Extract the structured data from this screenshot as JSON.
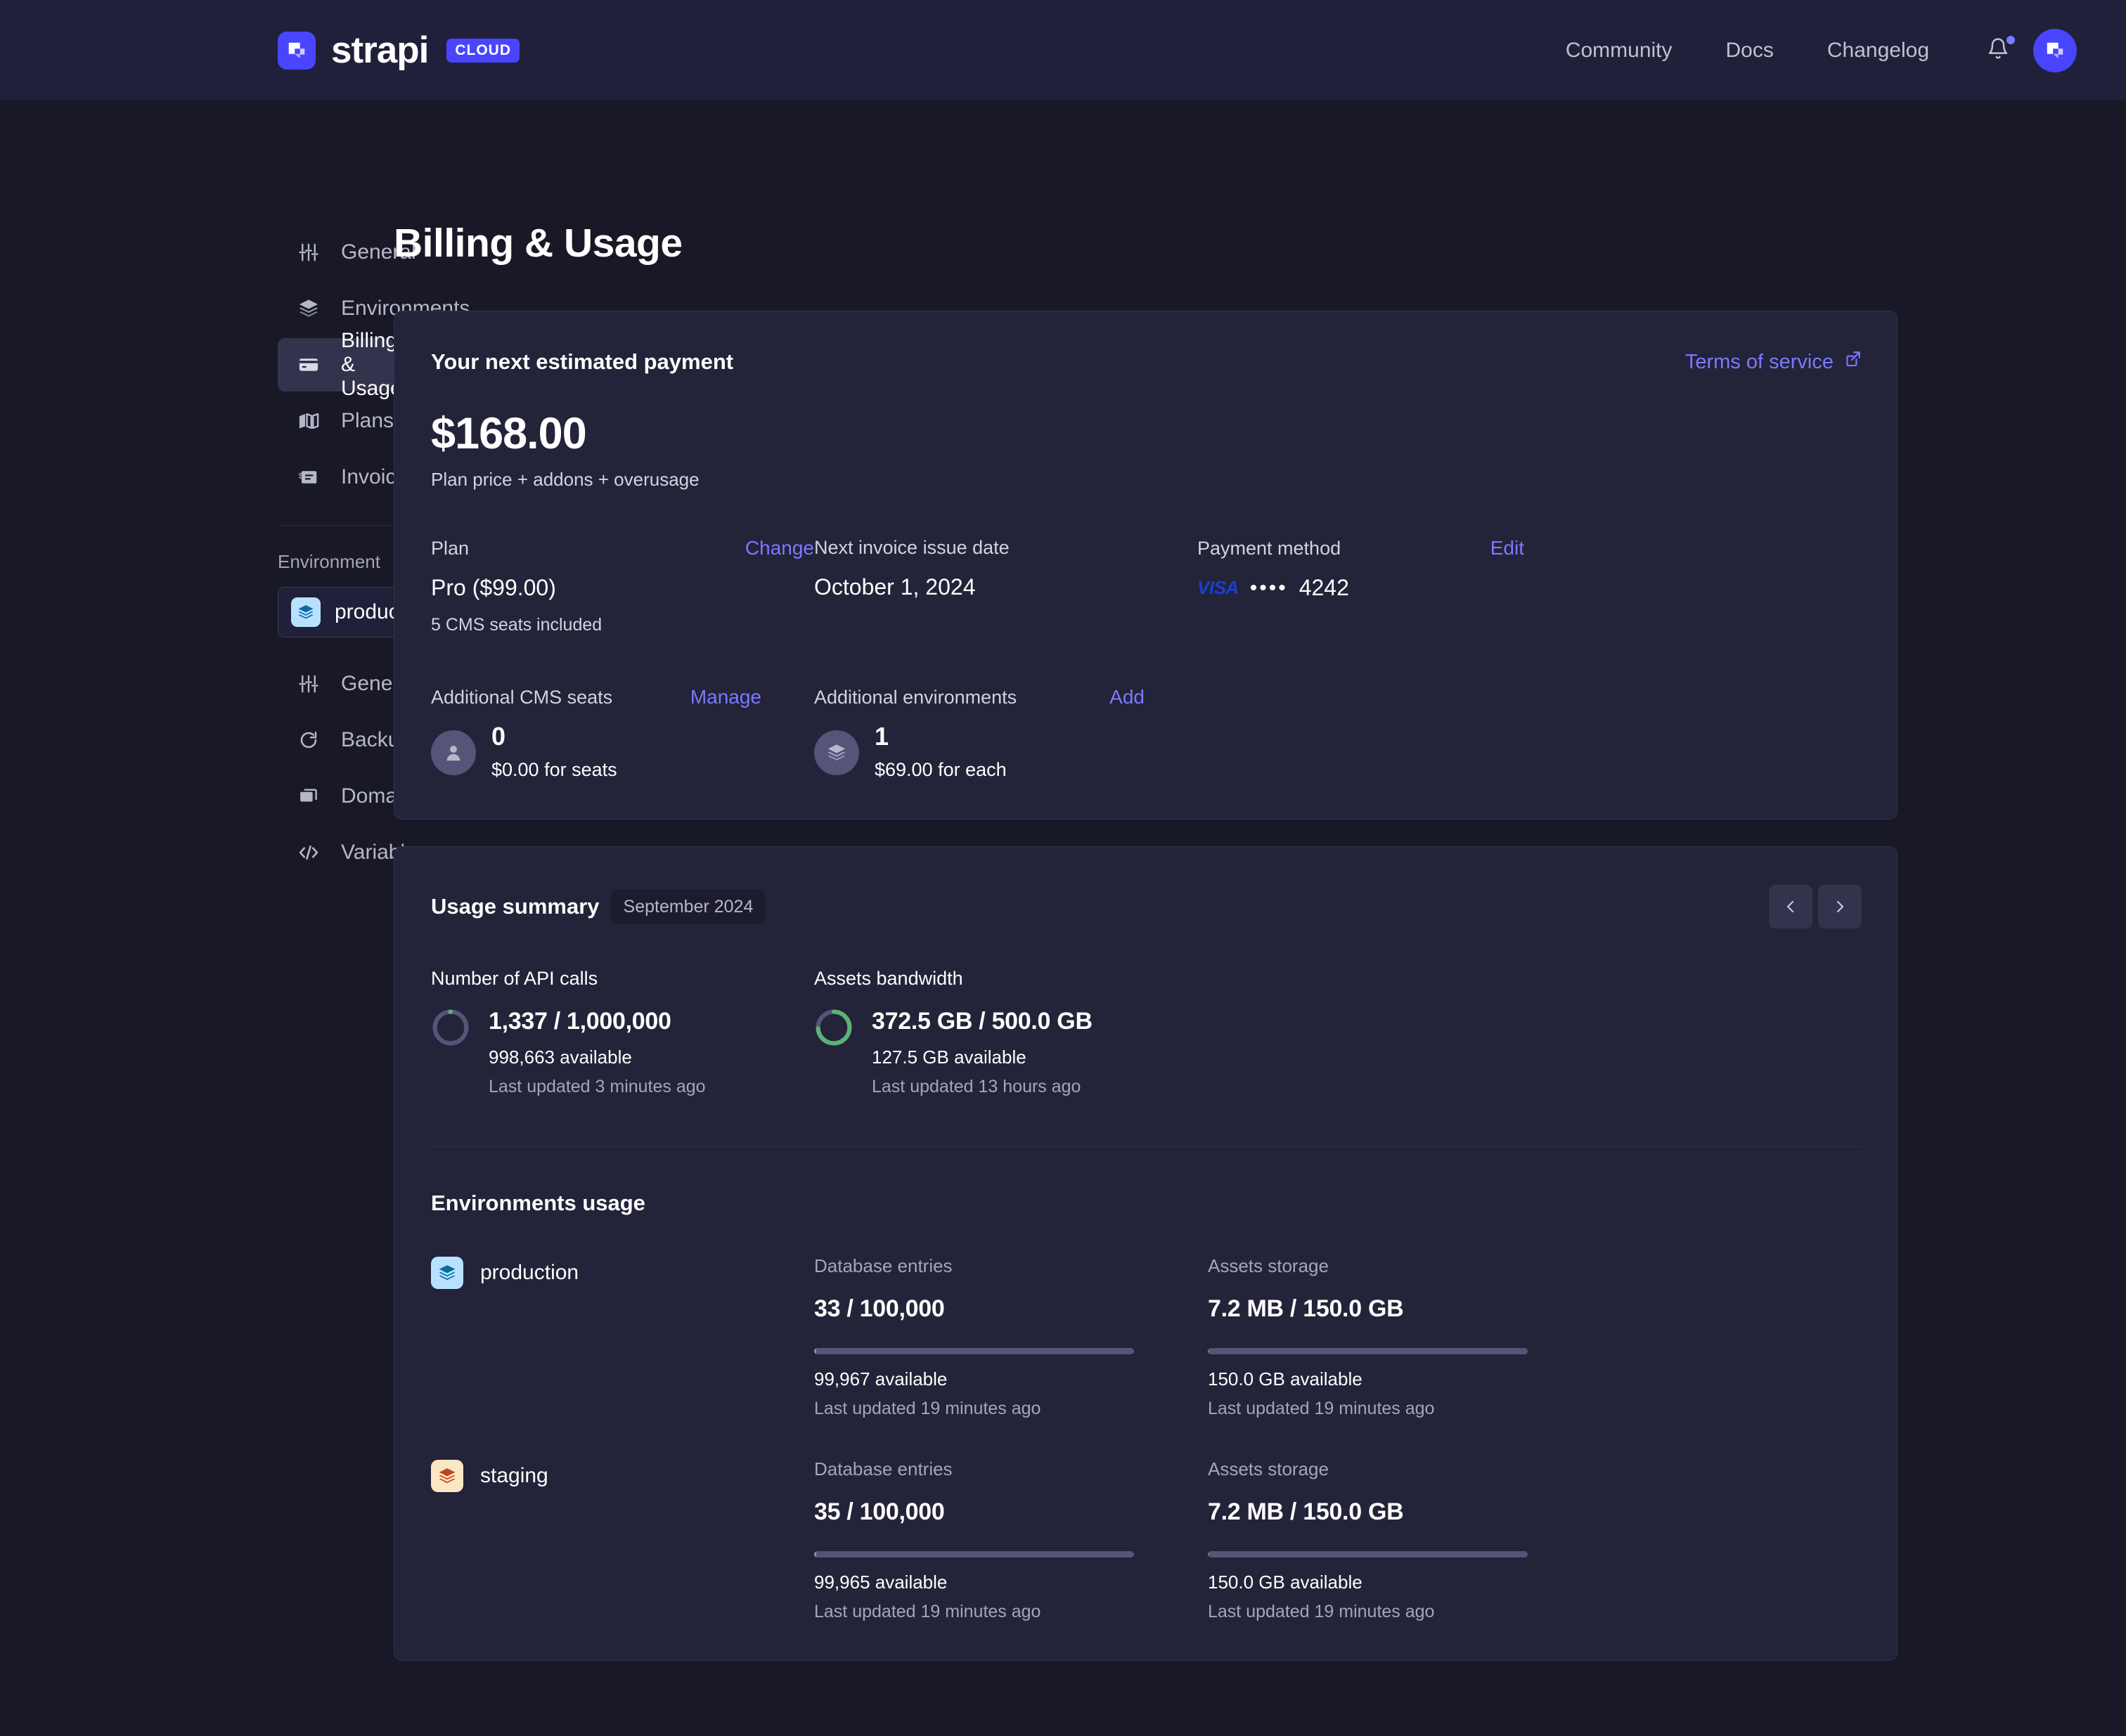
{
  "brand": {
    "word": "strapi",
    "badge": "CLOUD"
  },
  "topnav": {
    "links": [
      {
        "label": "Community"
      },
      {
        "label": "Docs"
      },
      {
        "label": "Changelog"
      }
    ],
    "notifications_icon": "bell-icon",
    "avatar_icon": "strapi-avatar-icon"
  },
  "sidebar": {
    "project_items": [
      {
        "label": "General",
        "icon": "sliders-icon",
        "active": false
      },
      {
        "label": "Environments",
        "icon": "layers-icon",
        "active": false
      },
      {
        "label": "Billing & Usage",
        "icon": "credit-card-icon",
        "active": true
      },
      {
        "label": "Plans",
        "icon": "map-icon",
        "active": false
      },
      {
        "label": "Invoices",
        "icon": "invoice-icon",
        "active": false
      }
    ],
    "environment_group_label": "Environment",
    "environment_selected": "production",
    "environment_items": [
      {
        "label": "General",
        "icon": "sliders-icon"
      },
      {
        "label": "Backups",
        "icon": "refresh-icon"
      },
      {
        "label": "Domains",
        "icon": "window-icon"
      },
      {
        "label": "Variables",
        "icon": "code-icon"
      }
    ]
  },
  "page_title": "Billing & Usage",
  "payment_card": {
    "title": "Your next estimated payment",
    "terms_link": "Terms of service",
    "amount": "$168.00",
    "amount_sub": "Plan price + addons + overusage",
    "plan": {
      "label": "Plan",
      "action": "Change",
      "value": "Pro ($99.00)",
      "note": "5 CMS seats included"
    },
    "next_invoice": {
      "label": "Next invoice issue date",
      "value": "October 1, 2024"
    },
    "payment_method": {
      "label": "Payment method",
      "action": "Edit",
      "brand": "VISA",
      "dots": "••••",
      "last4": "4242"
    },
    "addons": [
      {
        "label": "Additional CMS seats",
        "action": "Manage",
        "icon": "user-icon",
        "count": "0",
        "note": "$0.00 for seats"
      },
      {
        "label": "Additional environments",
        "action": "Add",
        "icon": "layers-icon",
        "count": "1",
        "note": "$69.00 for each"
      }
    ]
  },
  "usage_card": {
    "title": "Usage summary",
    "month": "September 2024",
    "prev_label": "‹",
    "next_label": "›",
    "metrics": [
      {
        "label": "Number of API calls",
        "value": "1,337 / 1,000,000",
        "available": "998,663 available",
        "updated": "Last updated 3 minutes ago",
        "percent": 0.13
      },
      {
        "label": "Assets bandwidth",
        "value": "372.5 GB / 500.0 GB",
        "available": "127.5 GB available",
        "updated": "Last updated 13 hours ago",
        "percent": 74.5
      }
    ],
    "environments_title": "Environments usage",
    "environments": [
      {
        "name": "production",
        "chip_color": "#b8e1ff",
        "metrics": [
          {
            "label": "Database entries",
            "value": "33 / 100,000",
            "available": "99,967 available",
            "updated": "Last updated 19 minutes ago",
            "percent": 0.6
          },
          {
            "label": "Assets storage",
            "value": "7.2 MB / 150.0 GB",
            "available": "150.0 GB available",
            "updated": "Last updated 19 minutes ago",
            "percent": 0.3
          }
        ]
      },
      {
        "name": "staging",
        "chip_color": "#fae7c3",
        "metrics": [
          {
            "label": "Database entries",
            "value": "35 / 100,000",
            "available": "99,965 available",
            "updated": "Last updated 19 minutes ago",
            "percent": 0.6
          },
          {
            "label": "Assets storage",
            "value": "7.2 MB / 150.0 GB",
            "available": "150.0 GB available",
            "updated": "Last updated 19 minutes ago",
            "percent": 0.3
          }
        ]
      }
    ]
  },
  "colors": {
    "accent": "#4945ff",
    "link": "#7b79ff",
    "success": "#5cb176",
    "track": "#55557a",
    "card_bg": "#232339",
    "page_bg": "#181826",
    "topbar_bg": "#20203a"
  }
}
